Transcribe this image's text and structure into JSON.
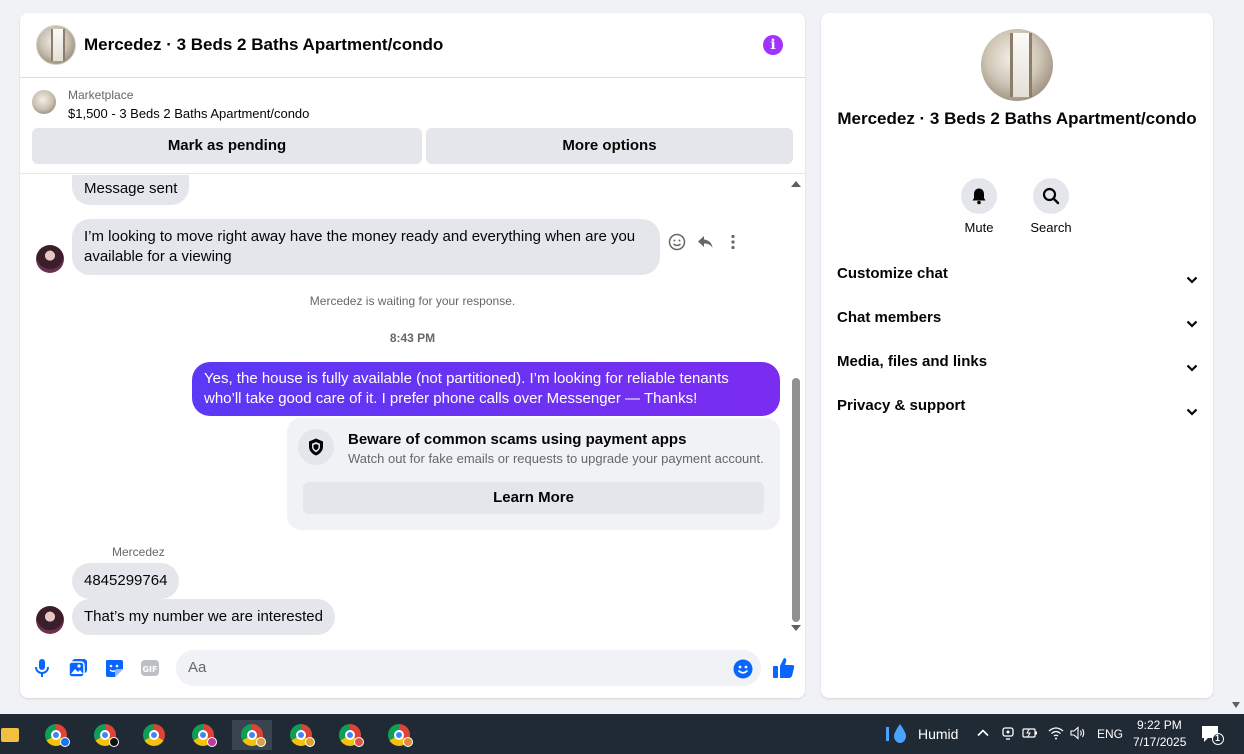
{
  "chat": {
    "title": "Mercedez · 3 Beds 2 Baths Apartment/condo",
    "marketplace_label": "Marketplace",
    "listing": "$1,500 - 3 Beds 2 Baths Apartment/condo",
    "mark_pending": "Mark as pending",
    "more_options": "More options",
    "messages": {
      "sent_status": "Message sent",
      "incoming_1": "I’m looking to move right away have the money ready and everything when are you available for a viewing",
      "waiting": "Mercedez is waiting for your response.",
      "time": "8:43 PM",
      "outgoing_1": "Yes, the house is fully available (not partitioned). I’m looking for reliable tenants who’ll take good care of it. I prefer phone calls over Messenger —  Thanks!",
      "scam_title": "Beware of common scams using payment apps",
      "scam_desc": "Watch out for fake emails or requests to upgrade your payment account.",
      "learn_more": "Learn More",
      "sender": "Mercedez",
      "incoming_2": "4845299764",
      "incoming_3": "That’s my number we are interested"
    },
    "composer_placeholder": "Aa",
    "colors": {
      "accent": "#0866ff",
      "outgoing": "#6a2bf2",
      "info": "#a033ff"
    }
  },
  "side": {
    "title": "Mercedez · 3 Beds 2 Baths Apartment/condo",
    "mute": "Mute",
    "search": "Search",
    "rows": [
      "Customize chat",
      "Chat members",
      "Media, files and links",
      "Privacy & support"
    ]
  },
  "taskbar": {
    "weather": "Humid",
    "lang": "ENG",
    "time": "9:22 PM",
    "date": "7/17/2025",
    "notif_count": "1"
  }
}
